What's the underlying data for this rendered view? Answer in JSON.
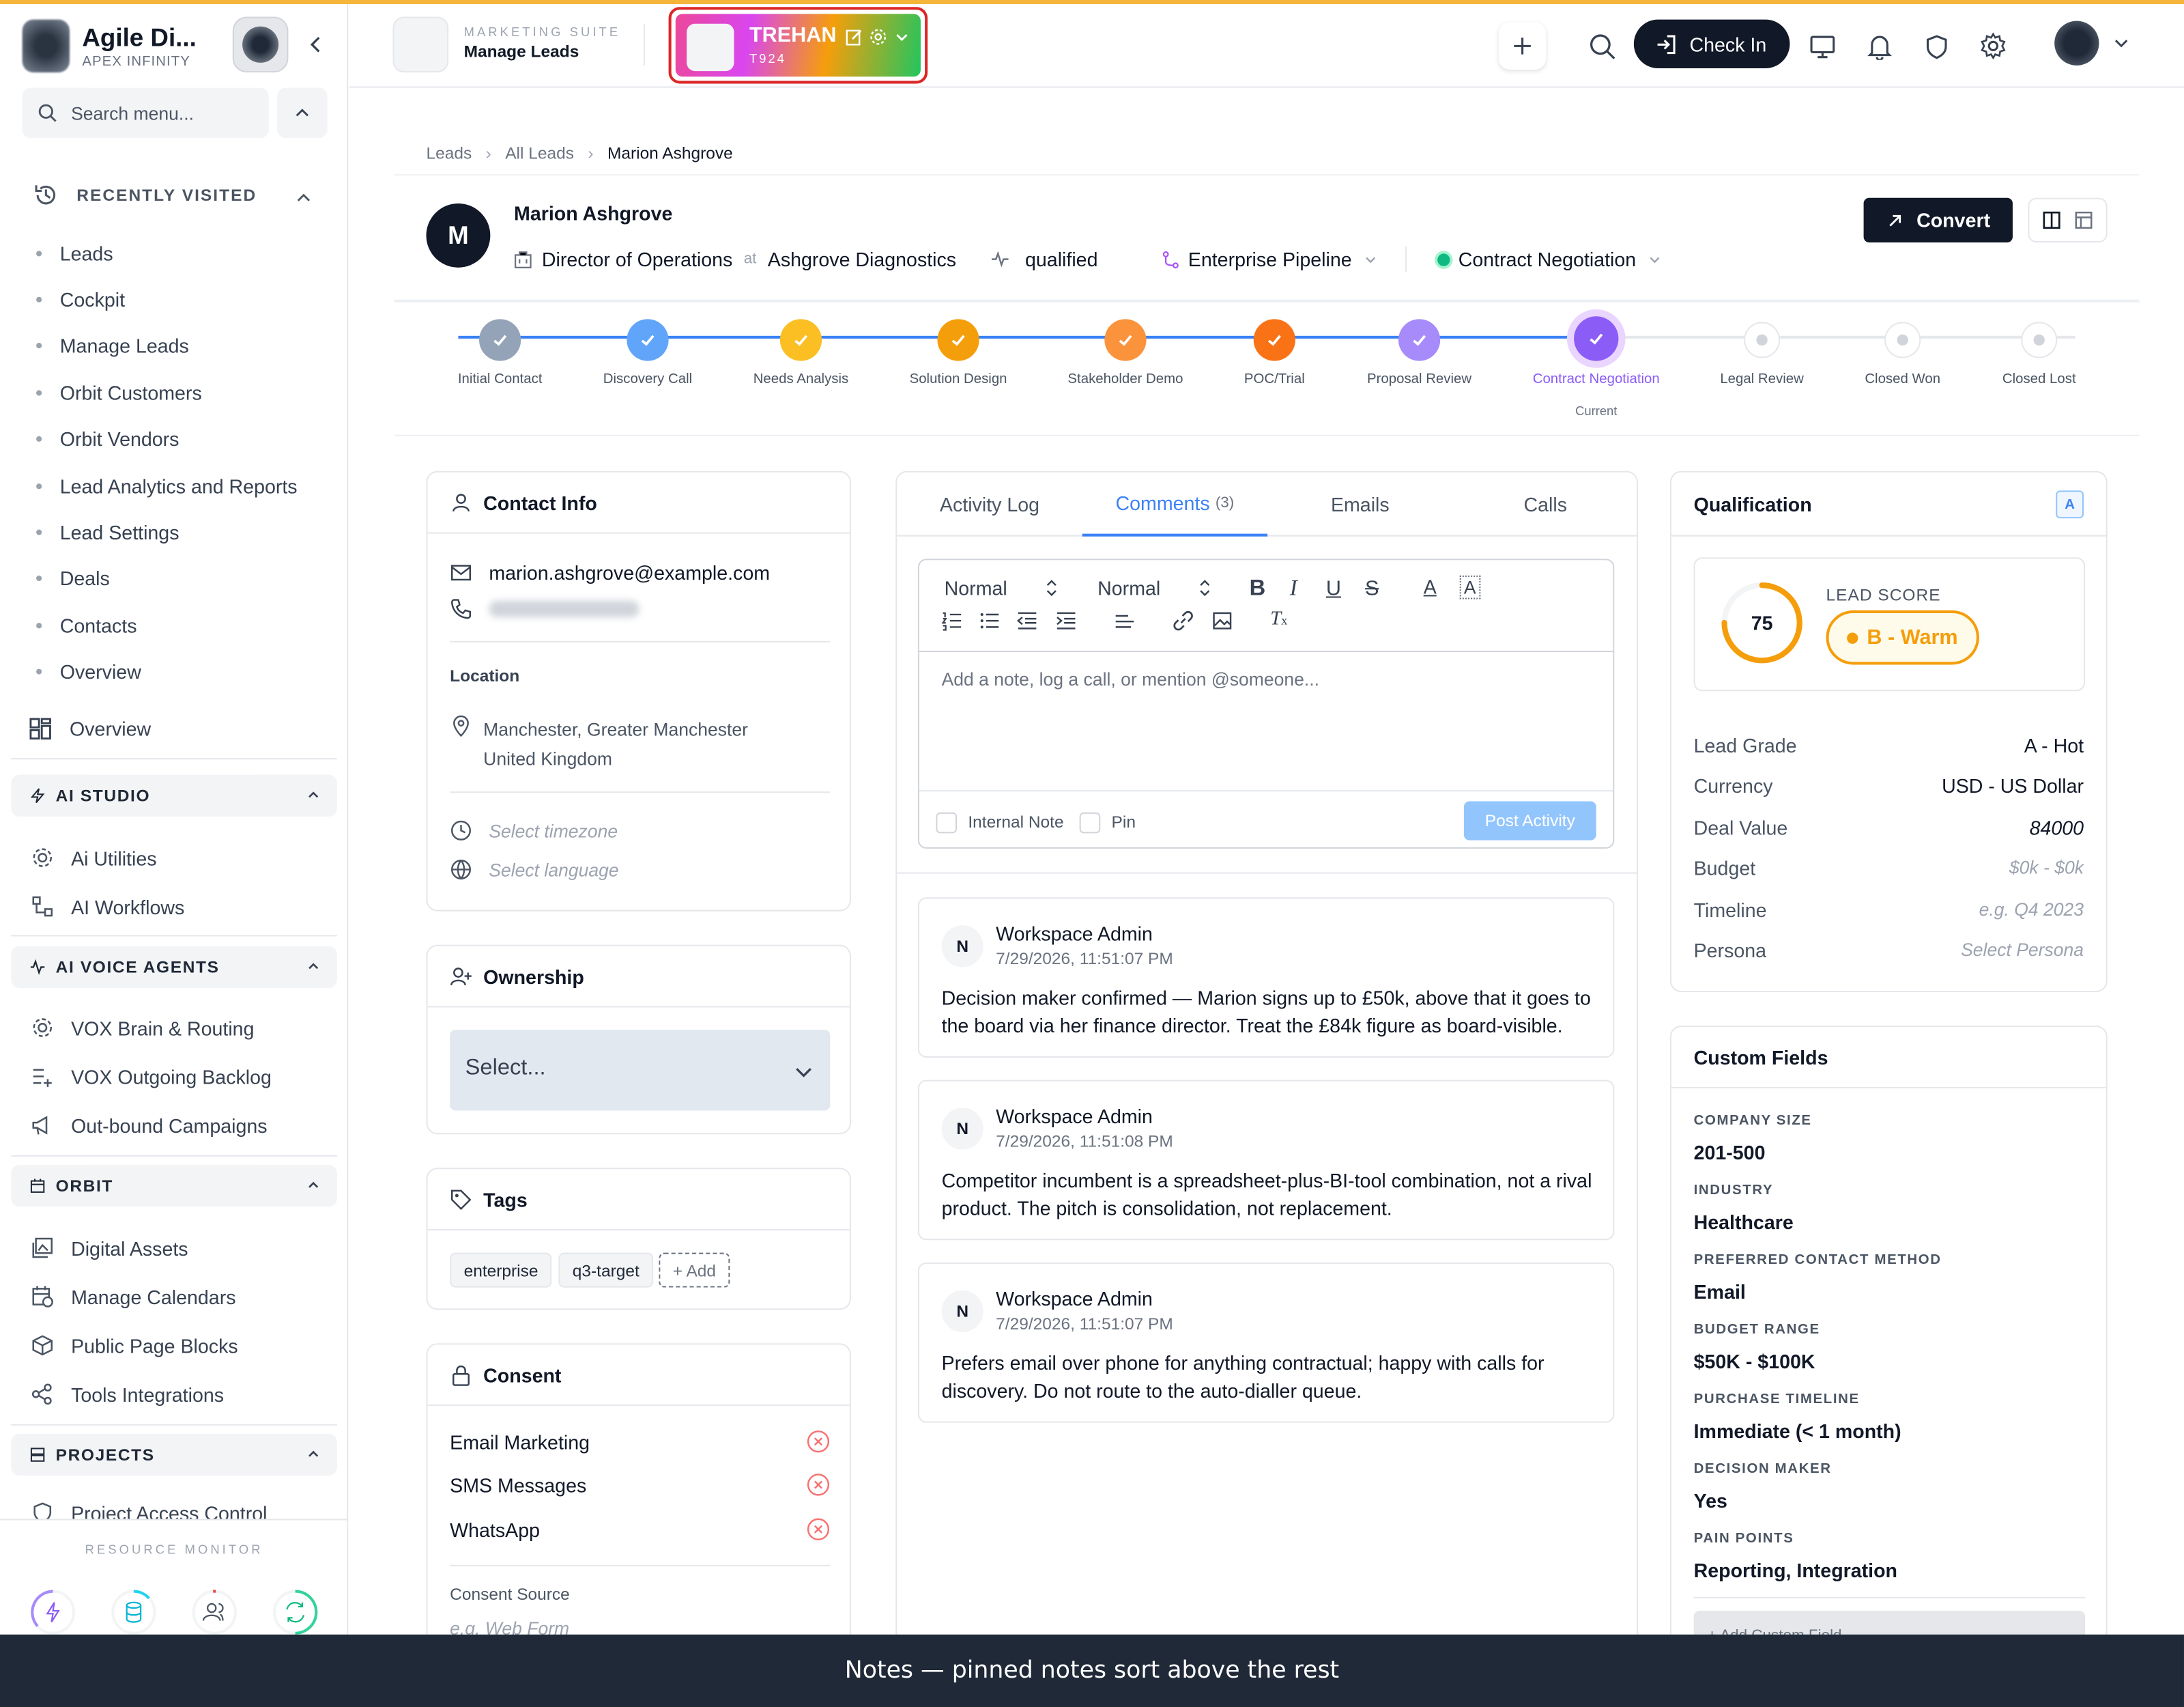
{
  "sidebar": {
    "org_name": "Agile Di...",
    "org_sub": "APEX INFINITY",
    "search_placeholder": "Search menu...",
    "recently_visited": {
      "label": "RECENTLY VISITED",
      "items": [
        "Leads",
        "Cockpit",
        "Manage Leads",
        "Orbit Customers",
        "Orbit Vendors",
        "Lead Analytics and Reports",
        "Lead Settings",
        "Deals",
        "Contacts",
        "Overview"
      ]
    },
    "overview": "Overview",
    "sections": [
      {
        "label": "AI STUDIO",
        "items": [
          "Ai Utilities",
          "AI Workflows"
        ]
      },
      {
        "label": "AI VOICE AGENTS",
        "items": [
          "VOX Brain & Routing",
          "VOX Outgoing Backlog",
          "Out-bound Campaigns"
        ]
      },
      {
        "label": "ORBIT",
        "items": [
          "Digital Assets",
          "Manage Calendars",
          "Public Page Blocks",
          "Tools Integrations"
        ]
      },
      {
        "label": "PROJECTS",
        "items": [
          "Project Access Control"
        ]
      }
    ],
    "resource_monitor": "RESOURCE MONITOR"
  },
  "header": {
    "suite_sub": "MARKETING SUITE",
    "suite_title": "Manage Leads",
    "tenant_name": "TREHAN",
    "tenant_code": "T924",
    "check_in": "Check In"
  },
  "breadcrumb": [
    "Leads",
    "All Leads",
    "Marion Ashgrove"
  ],
  "lead": {
    "initial": "M",
    "name": "Marion Ashgrove",
    "title": "Director of Operations",
    "at": "at",
    "company": "Ashgrove Diagnostics",
    "status": "qualified",
    "pipeline": "Enterprise Pipeline",
    "stage": "Contract Negotiation",
    "convert": "Convert"
  },
  "stages": [
    {
      "label": "Initial Contact",
      "state": "done",
      "color": "#94a3b8"
    },
    {
      "label": "Discovery Call",
      "state": "done",
      "color": "#60a5fa"
    },
    {
      "label": "Needs Analysis",
      "state": "done",
      "color": "#fbbf24"
    },
    {
      "label": "Solution Design",
      "state": "done",
      "color": "#f59e0b"
    },
    {
      "label": "Stakeholder Demo",
      "state": "done",
      "color": "#fb923c"
    },
    {
      "label": "POC/Trial",
      "state": "done",
      "color": "#f97316"
    },
    {
      "label": "Proposal Review",
      "state": "done",
      "color": "#a78bfa"
    },
    {
      "label": "Contract Negotiation",
      "state": "current",
      "color": "#8b5cf6"
    },
    {
      "label": "Legal Review",
      "state": "pending",
      "color": "#d1d5db"
    },
    {
      "label": "Closed Won",
      "state": "pending",
      "color": "#d1d5db"
    },
    {
      "label": "Closed Lost",
      "state": "pending",
      "color": "#d1d5db"
    }
  ],
  "current_label": "Current",
  "contact": {
    "title": "Contact Info",
    "email": "marion.ashgrove@example.com",
    "location_label": "Location",
    "location_line1": "Manchester, Greater Manchester",
    "location_line2": "United Kingdom",
    "timezone_placeholder": "Select timezone",
    "language_placeholder": "Select language"
  },
  "ownership": {
    "title": "Ownership",
    "select": "Select..."
  },
  "tags": {
    "title": "Tags",
    "items": [
      "enterprise",
      "q3-target"
    ],
    "add": "+ Add"
  },
  "consent": {
    "title": "Consent",
    "items": [
      "Email Marketing",
      "SMS Messages",
      "WhatsApp"
    ],
    "source_label": "Consent Source",
    "source_placeholder": "e.g. Web Form"
  },
  "activity": {
    "tabs": [
      {
        "label": "Activity Log",
        "count": ""
      },
      {
        "label": "Comments",
        "count": "(3)"
      },
      {
        "label": "Emails",
        "count": ""
      },
      {
        "label": "Calls",
        "count": ""
      }
    ],
    "format1": "Normal",
    "format2": "Normal",
    "placeholder": "Add a note, log a call, or mention @someone...",
    "internal_note": "Internal Note",
    "pin": "Pin",
    "post": "Post Activity",
    "notes": [
      {
        "initial": "N",
        "author": "Workspace Admin",
        "time": "7/29/2026, 11:51:07 PM",
        "body": "Decision maker confirmed — Marion signs up to £50k, above that it goes to the board via her finance director. Treat the £84k figure as board-visible."
      },
      {
        "initial": "N",
        "author": "Workspace Admin",
        "time": "7/29/2026, 11:51:08 PM",
        "body": "Competitor incumbent is a spreadsheet-plus-BI-tool combination, not a rival product. The pitch is consolidation, not replacement."
      },
      {
        "initial": "N",
        "author": "Workspace Admin",
        "time": "7/29/2026, 11:51:07 PM",
        "body": "Prefers email over phone for anything contractual; happy with calls for discovery. Do not route to the auto-dialler queue."
      }
    ]
  },
  "qualification": {
    "title": "Qualification",
    "badge": "A",
    "score": 75,
    "score_label": "LEAD SCORE",
    "warmth": "B - Warm",
    "rows": [
      {
        "k": "Lead Grade",
        "v": "A - Hot",
        "style": "plain"
      },
      {
        "k": "Currency",
        "v": "USD - US Dollar",
        "style": "plain"
      },
      {
        "k": "Deal Value",
        "v": "84000",
        "style": "italic"
      },
      {
        "k": "Budget",
        "v": "$0k - $0k",
        "style": "placeholder"
      },
      {
        "k": "Timeline",
        "v": "e.g. Q4 2023",
        "style": "placeholder"
      },
      {
        "k": "Persona",
        "v": "Select Persona",
        "style": "placeholder"
      }
    ]
  },
  "custom_fields": {
    "title": "Custom Fields",
    "items": [
      {
        "k": "COMPANY SIZE",
        "v": "201-500"
      },
      {
        "k": "INDUSTRY",
        "v": "Healthcare"
      },
      {
        "k": "PREFERRED CONTACT METHOD",
        "v": "Email"
      },
      {
        "k": "BUDGET RANGE",
        "v": "$50K - $100K"
      },
      {
        "k": "PURCHASE TIMELINE",
        "v": "Immediate (< 1 month)"
      },
      {
        "k": "DECISION MAKER",
        "v": "Yes"
      },
      {
        "k": "PAIN POINTS",
        "v": "Reporting, Integration"
      }
    ],
    "add": "+ Add Custom Field"
  },
  "toast": "Notes — pinned notes sort above the rest",
  "colors": {
    "accent": "#3b82f6",
    "dark": "#111827",
    "warm": "#f59e0b",
    "current_stage": "#8b5cf6"
  }
}
